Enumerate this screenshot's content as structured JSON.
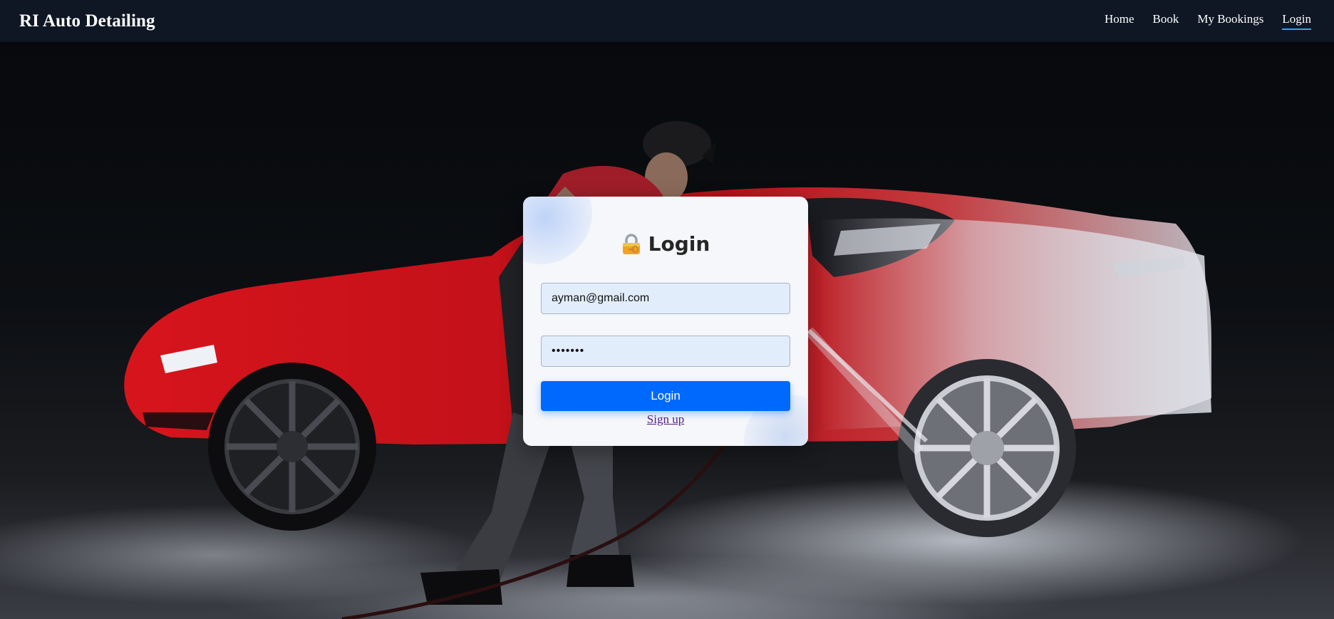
{
  "navbar": {
    "brand": "RI Auto Detailing",
    "links": [
      {
        "label": "Home",
        "active": false
      },
      {
        "label": "Book",
        "active": false
      },
      {
        "label": "My Bookings",
        "active": false
      },
      {
        "label": "Login",
        "active": true
      }
    ],
    "accent_color": "#2ea3ff"
  },
  "hero": {
    "image": "car-washing-photo",
    "subject": "worker pressure-washing red sports car"
  },
  "login_card": {
    "icon": "lock-key-icon",
    "title": "Login",
    "email": {
      "value": "ayman@gmail.com",
      "placeholder": "Email"
    },
    "password": {
      "value": "•••••••",
      "placeholder": "Password"
    },
    "submit_label": "Login",
    "signup_label": "Sign up",
    "button_color": "#0069fd"
  }
}
